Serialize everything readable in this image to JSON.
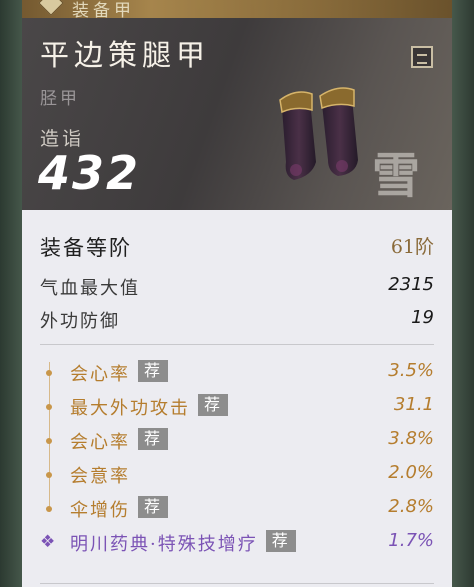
{
  "tab": {
    "label": "装备甲"
  },
  "item": {
    "name": "平边策腿甲",
    "type": "胫甲",
    "maker_label": "造诣",
    "score": "432",
    "watermark": "雪"
  },
  "grade": {
    "label": "装备等阶",
    "value": "61阶"
  },
  "base_stats": [
    {
      "label": "气血最大值",
      "value": "2315"
    },
    {
      "label": "外功防御",
      "value": "19"
    }
  ],
  "attributes": [
    {
      "name": "会心率",
      "tag": "荐",
      "value": "3.5%"
    },
    {
      "name": "最大外功攻击",
      "tag": "荐",
      "value": "31.1"
    },
    {
      "name": "会心率",
      "tag": "荐",
      "value": "3.8%"
    },
    {
      "name": "会意率",
      "tag": "",
      "value": "2.0%"
    },
    {
      "name": "伞增伤",
      "tag": "荐",
      "value": "2.8%"
    },
    {
      "name": "明川药典·特殊技增疗",
      "tag": "荐",
      "value": "1.7%"
    }
  ],
  "colors": {
    "gold": "#b57d2e",
    "purple": "#7b53b5",
    "tag_bg": "#8d8d8d"
  }
}
